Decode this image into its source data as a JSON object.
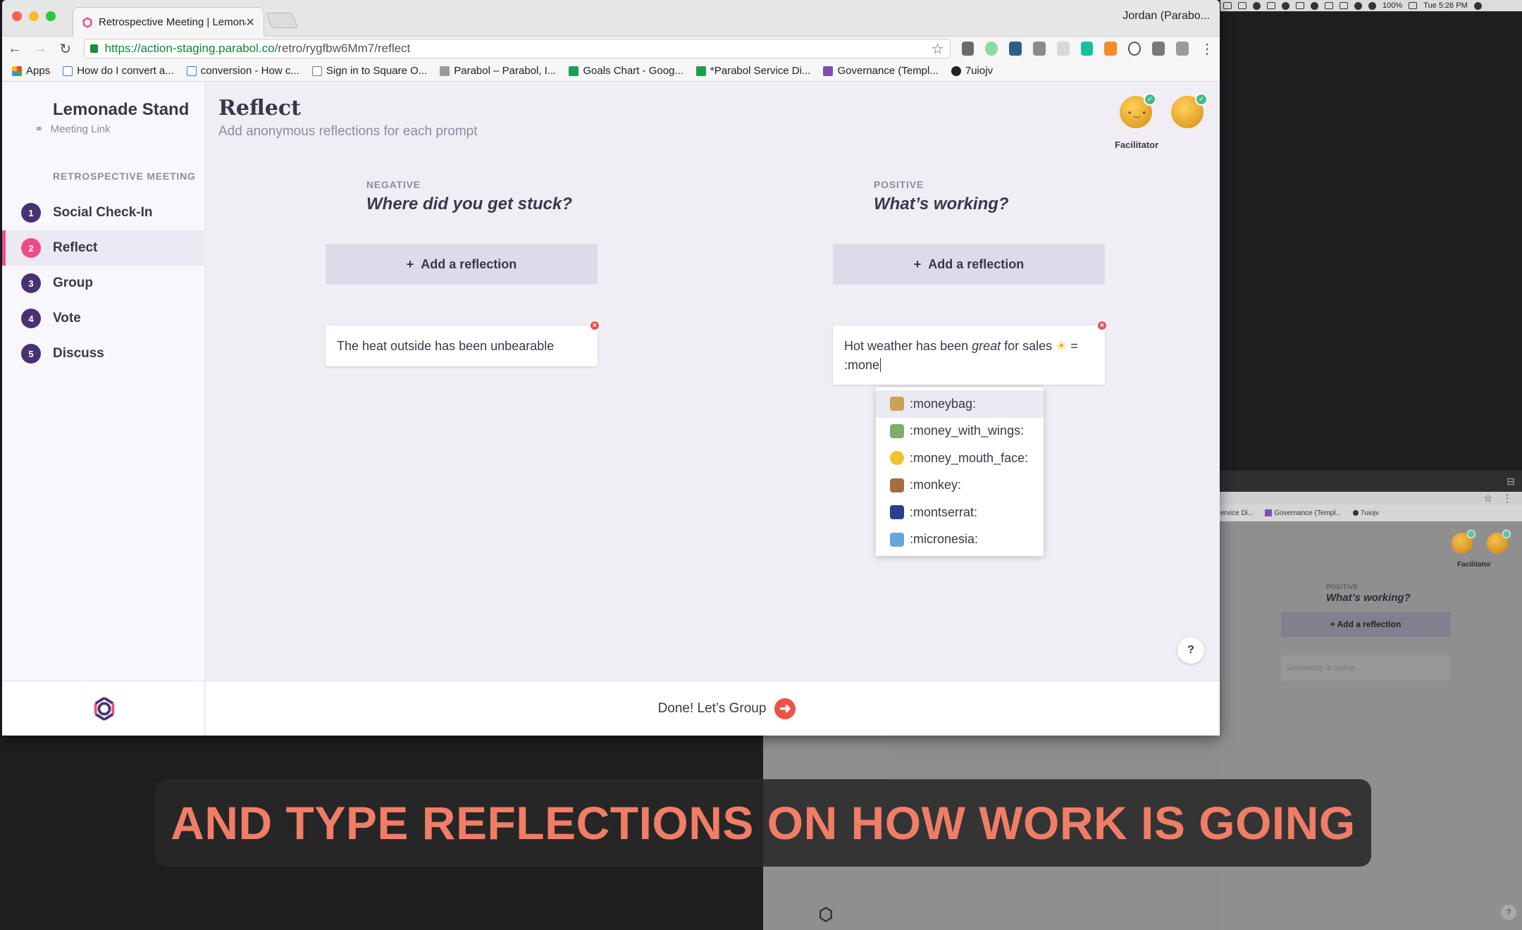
{
  "colors": {
    "accent": "#ed4c86",
    "primary": "#493272",
    "caption": "#f07d66"
  },
  "browser": {
    "tab_title": "Retrospective Meeting | Lemonade Stand",
    "user": "Jordan (Parabo...",
    "url_host": "https://action-staging.parabol.co",
    "url_path": "/retro/rygfbw6Mm7/reflect",
    "bookmarks": [
      "Apps",
      "How do I convert a...",
      "conversion - How c...",
      "Sign in to Square O...",
      "Parabol – Parabol, I...",
      "Goals Chart - Goog...",
      "*Parabol Service Di...",
      "Governance (Templ...",
      "7uiojv"
    ]
  },
  "macbar": {
    "battery": "100%",
    "time": "Tue 5:26 PM"
  },
  "sidebar": {
    "team": "Lemonade Stand",
    "meeting_link": "Meeting Link",
    "section_label": "RETROSPECTIVE MEETING",
    "items": [
      {
        "num": "1",
        "label": "Social Check-In"
      },
      {
        "num": "2",
        "label": "Reflect"
      },
      {
        "num": "3",
        "label": "Group"
      },
      {
        "num": "4",
        "label": "Vote"
      },
      {
        "num": "5",
        "label": "Discuss"
      }
    ]
  },
  "main": {
    "title": "Reflect",
    "subtitle": "Add anonymous reflections for each prompt",
    "facilitator": "Facilitator",
    "columns": [
      {
        "category": "NEGATIVE",
        "prompt": "Where did you get stuck?",
        "add_label": "Add a reflection",
        "plus": "+"
      },
      {
        "category": "POSITIVE",
        "prompt": "What’s working?",
        "add_label": "Add a reflection",
        "plus": "+"
      }
    ],
    "card_negative": "The heat outside has been unbearable",
    "card_positive": {
      "before": "Hot weather has been ",
      "emph": "great",
      "after": " for sales ",
      "sun": "☀",
      "eq": " =",
      "line2": ":mone"
    },
    "emoji_suggestions": [
      {
        "code": ":moneybag:",
        "color": "#c9a25a"
      },
      {
        "code": ":money_with_wings:",
        "color": "#7fae6a"
      },
      {
        "code": ":money_mouth_face:",
        "color": "#f2c232"
      },
      {
        "code": ":monkey:",
        "color": "#a66b3e"
      },
      {
        "code": ":montserrat:",
        "color": "#2b3f8f"
      },
      {
        "code": ":micronesia:",
        "color": "#6aa5d9"
      }
    ],
    "help": "?",
    "done_label": "Done! Let’s Group"
  },
  "bg_window": {
    "bookmarks": [
      "ervice Di...",
      "Governance (Templ...",
      "7uiojv"
    ],
    "facilitator": "Facilitator",
    "category": "POSITIVE",
    "prompt": "What’s working?",
    "add_label": "+ Add a reflection",
    "typing": "Somebody is typing...",
    "help": "?"
  },
  "caption": "AND TYPE REFLECTIONS ON HOW WORK IS GOING"
}
